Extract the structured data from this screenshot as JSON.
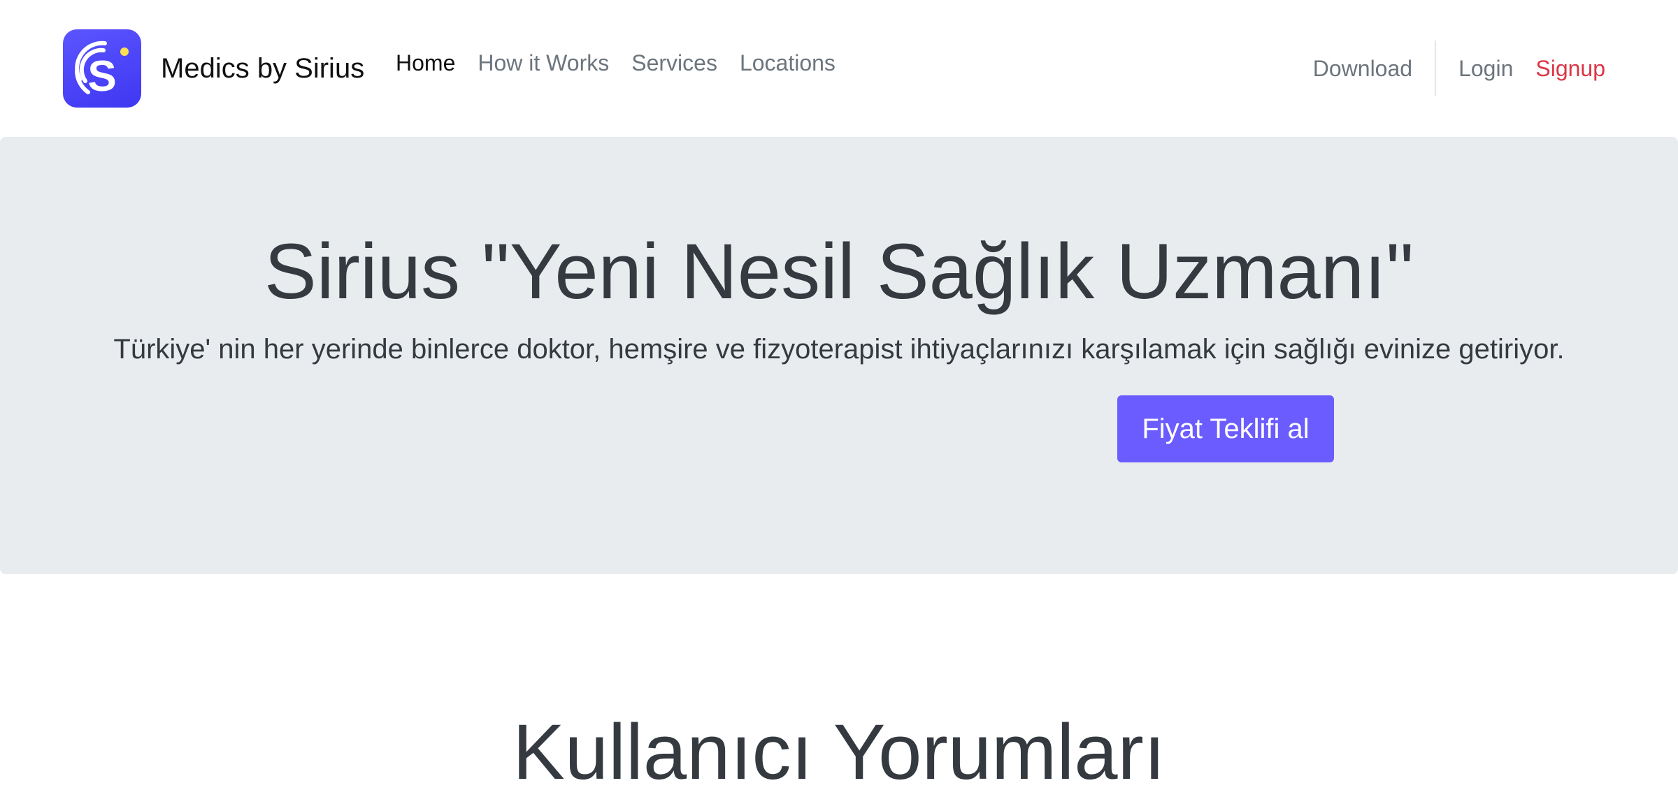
{
  "navbar": {
    "brand_name": "Medics by Sirius",
    "logo_icon": "sirius-s-logo-icon",
    "accent_color": "#4b44f8",
    "links": [
      {
        "label": "Home",
        "active": true
      },
      {
        "label": "How it Works",
        "active": false
      },
      {
        "label": "Services",
        "active": false
      },
      {
        "label": "Locations",
        "active": false
      }
    ],
    "right_links": {
      "download": "Download",
      "login": "Login",
      "signup": "Signup"
    },
    "signup_color": "#dc3545"
  },
  "hero": {
    "title": "Sirius \"Yeni Nesil Sağlık Uzmanı\"",
    "subtitle": "Türkiye' nin her yerinde binlerce doktor, hemşire ve fizyoterapist ihtiyaçlarınızı karşılamak için sağlığı evinize getiriyor.",
    "cta_label": "Fiyat Teklifi al",
    "cta_color": "#6b5cff",
    "background": "#e9ecef"
  },
  "testimonials": {
    "title": "Kullanıcı Yorumları"
  }
}
